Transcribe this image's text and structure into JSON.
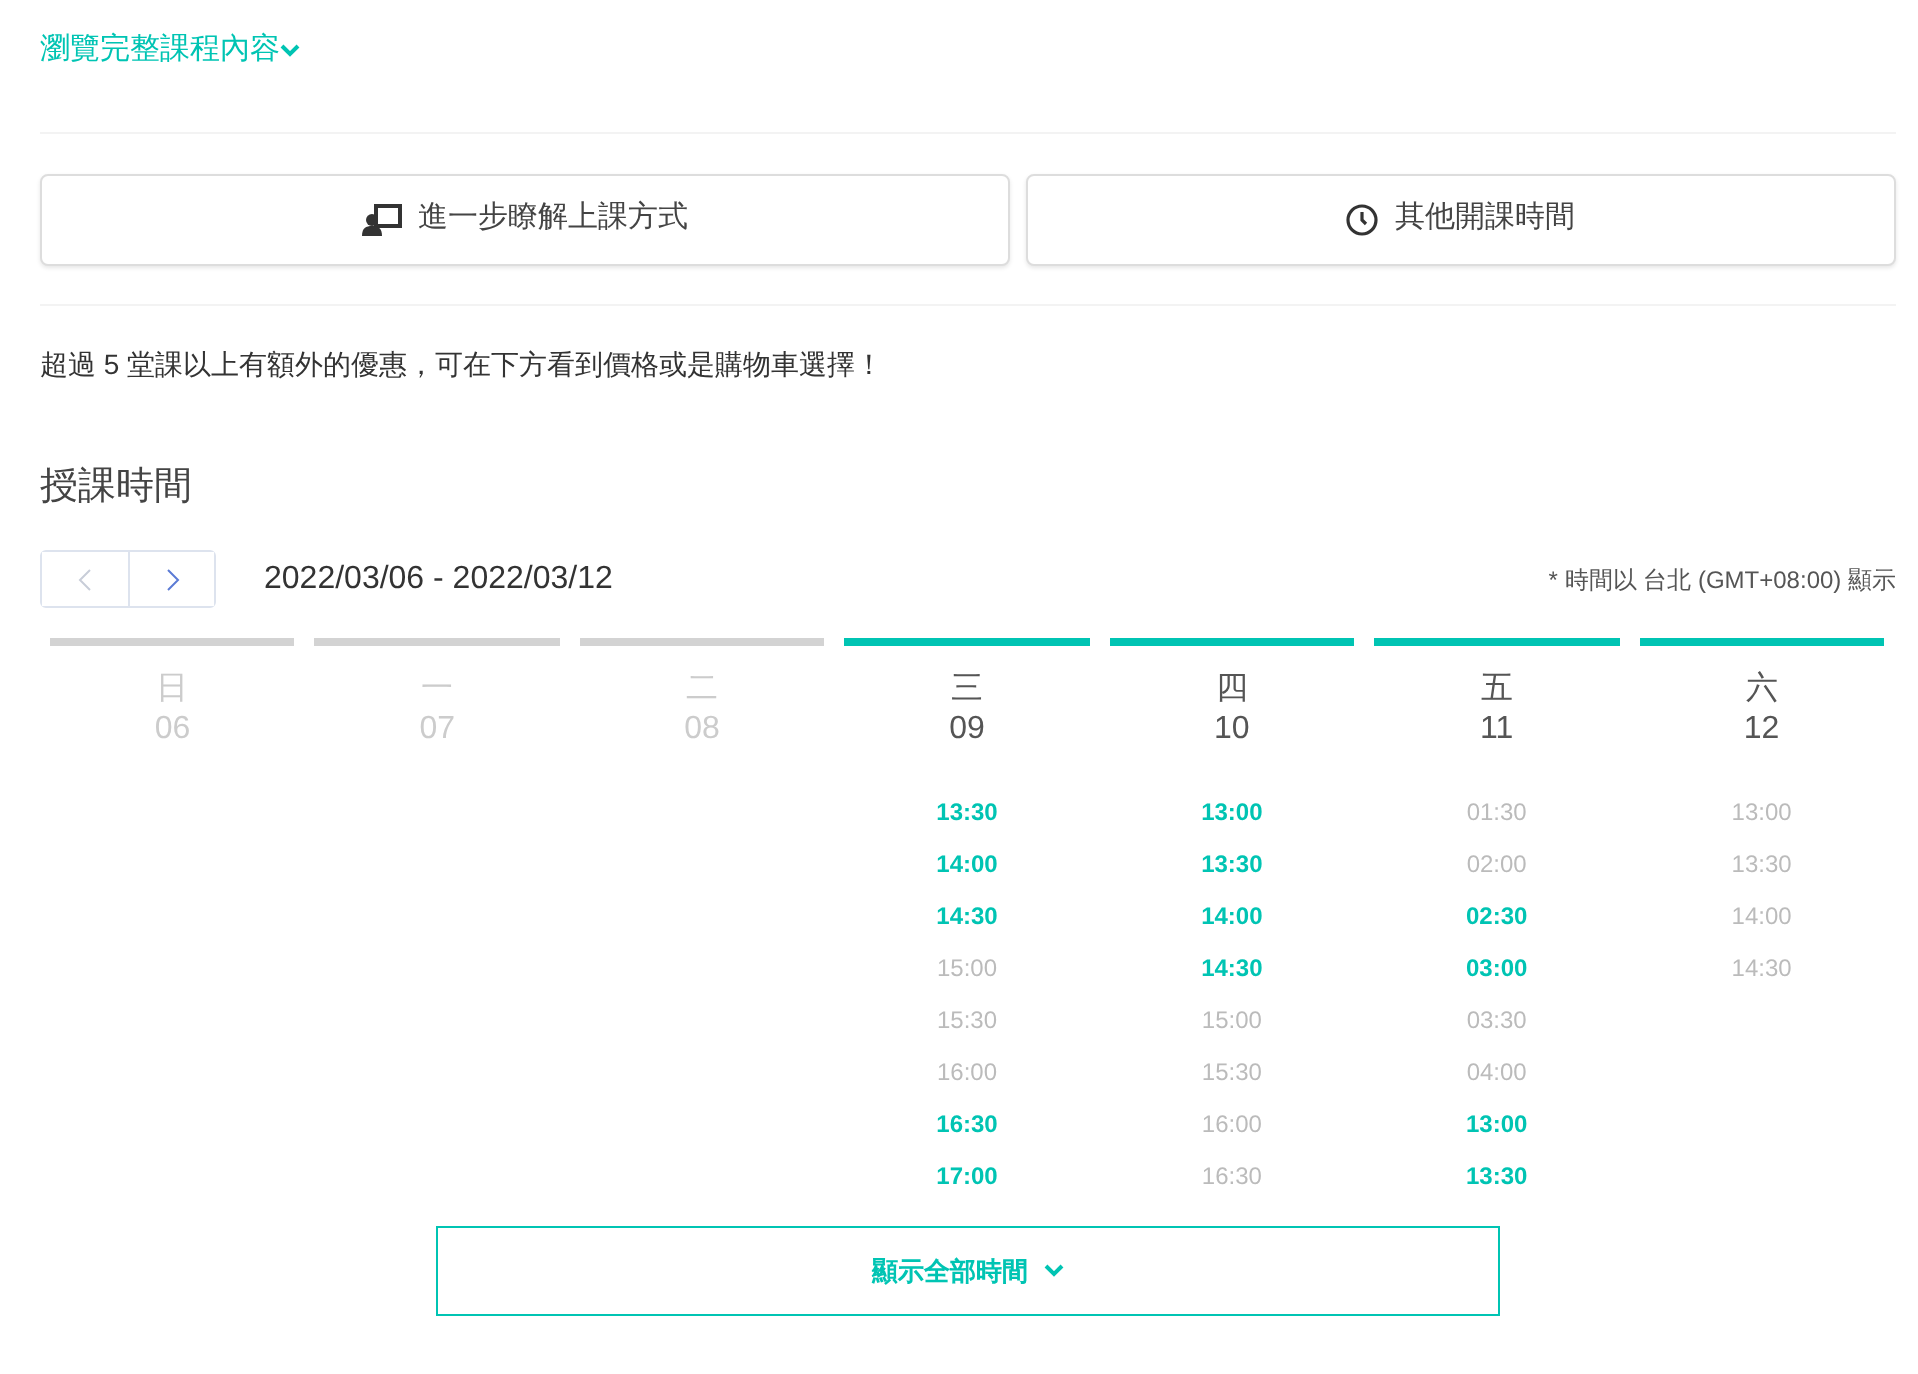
{
  "course_link": {
    "label": "瀏覽完整課程內容"
  },
  "buttons": [
    {
      "kind": "teaching",
      "label": "進一步瞭解上課方式"
    },
    {
      "kind": "clock",
      "label": "其他開課時間"
    }
  ],
  "notice": "超過 5 堂課以上有額外的優惠，可在下方看到價格或是購物車選擇！",
  "schedule": {
    "title": "授課時間",
    "range": "2022/03/06 - 2022/03/12",
    "timezone_note": "* 時間以 台北 (GMT+08:00) 顯示",
    "days": [
      {
        "weekday": "日",
        "date": "06",
        "open": false
      },
      {
        "weekday": "一",
        "date": "07",
        "open": false
      },
      {
        "weekday": "二",
        "date": "08",
        "open": false
      },
      {
        "weekday": "三",
        "date": "09",
        "open": true,
        "slots": [
          {
            "time": "13:30",
            "available": true
          },
          {
            "time": "14:00",
            "available": true
          },
          {
            "time": "14:30",
            "available": true
          },
          {
            "time": "15:00",
            "available": false
          },
          {
            "time": "15:30",
            "available": false
          },
          {
            "time": "16:00",
            "available": false
          },
          {
            "time": "16:30",
            "available": true
          },
          {
            "time": "17:00",
            "available": true
          }
        ]
      },
      {
        "weekday": "四",
        "date": "10",
        "open": true,
        "slots": [
          {
            "time": "13:00",
            "available": true
          },
          {
            "time": "13:30",
            "available": true
          },
          {
            "time": "14:00",
            "available": true
          },
          {
            "time": "14:30",
            "available": true
          },
          {
            "time": "15:00",
            "available": false
          },
          {
            "time": "15:30",
            "available": false
          },
          {
            "time": "16:00",
            "available": false
          },
          {
            "time": "16:30",
            "available": false
          }
        ]
      },
      {
        "weekday": "五",
        "date": "11",
        "open": true,
        "slots": [
          {
            "time": "01:30",
            "available": false
          },
          {
            "time": "02:00",
            "available": false
          },
          {
            "time": "02:30",
            "available": true
          },
          {
            "time": "03:00",
            "available": true
          },
          {
            "time": "03:30",
            "available": false
          },
          {
            "time": "04:00",
            "available": false
          },
          {
            "time": "13:00",
            "available": true
          },
          {
            "time": "13:30",
            "available": true
          }
        ]
      },
      {
        "weekday": "六",
        "date": "12",
        "open": true,
        "slots": [
          {
            "time": "13:00",
            "available": false
          },
          {
            "time": "13:30",
            "available": false
          },
          {
            "time": "14:00",
            "available": false
          },
          {
            "time": "14:30",
            "available": false
          }
        ]
      }
    ],
    "show_all": {
      "label": "顯示全部時間"
    }
  }
}
